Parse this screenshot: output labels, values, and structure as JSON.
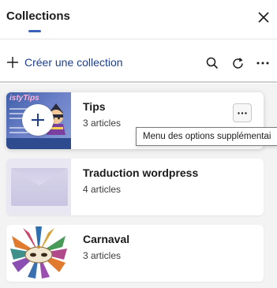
{
  "header": {
    "title": "Collections",
    "close_icon": "close-icon"
  },
  "toolbar": {
    "create_label": "Créer une collection",
    "icons": [
      "plus-icon",
      "search-icon",
      "refresh-icon",
      "more-icon"
    ]
  },
  "collections": [
    {
      "title": "Tips",
      "count": "3 articles",
      "thumbnail": "tips-thumbnail",
      "thumb_text": "istyTips"
    },
    {
      "title": "Traduction wordpress",
      "count": "4 articles",
      "thumbnail": "envelope-thumbnail"
    },
    {
      "title": "Carnaval",
      "count": "3 articles",
      "thumbnail": "carnival-mask-thumbnail"
    }
  ],
  "tooltip": {
    "text": "Menu des options supplémentai"
  },
  "colors": {
    "accent": "#3a62b8",
    "link": "#1b3e8f",
    "list_background": "#f3f3f3"
  }
}
